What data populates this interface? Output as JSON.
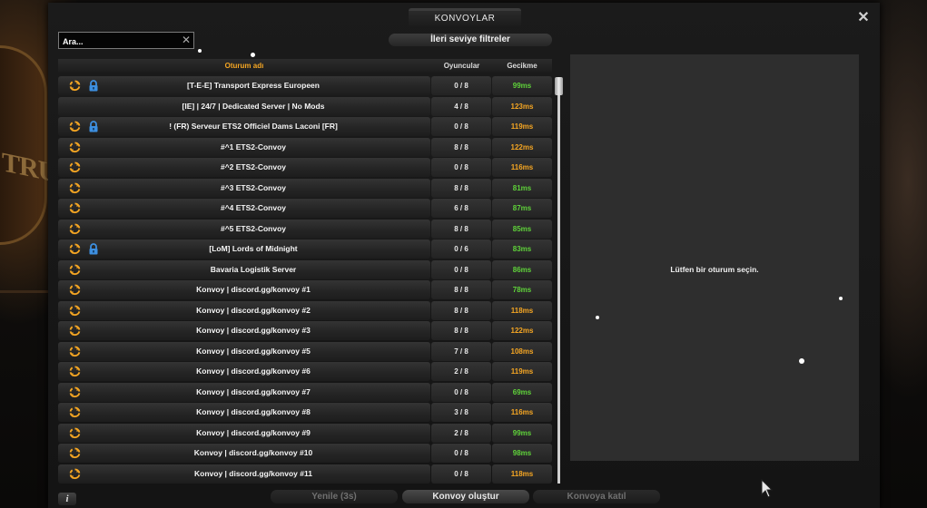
{
  "window": {
    "title": "KONVOYLAR",
    "close_label": "✕"
  },
  "search": {
    "placeholder": "Ara...",
    "value": ""
  },
  "filters_button": {
    "label": "İleri seviye filtreler"
  },
  "table": {
    "headers": {
      "name": "Oturum adı",
      "players": "Oyuncular",
      "delay": "Gecikme"
    },
    "rows": [
      {
        "name": "[T-E-E] Transport Express Europeen",
        "players": "0 / 8",
        "ping": "99ms",
        "ping_level": "good",
        "locked": true,
        "synced": true
      },
      {
        "name": "[IE] | 24/7 | Dedicated Server | No Mods",
        "players": "4 / 8",
        "ping": "123ms",
        "ping_level": "mid",
        "locked": false,
        "synced": false
      },
      {
        "name": "! (FR) Serveur ETS2 Officiel Dams Laconi [FR]",
        "players": "0 / 8",
        "ping": "119ms",
        "ping_level": "mid",
        "locked": true,
        "synced": true
      },
      {
        "name": "#^1 ETS2-Convoy",
        "players": "8 / 8",
        "ping": "122ms",
        "ping_level": "mid",
        "locked": false,
        "synced": true
      },
      {
        "name": "#^2 ETS2-Convoy",
        "players": "0 / 8",
        "ping": "116ms",
        "ping_level": "mid",
        "locked": false,
        "synced": true
      },
      {
        "name": "#^3 ETS2-Convoy",
        "players": "8 / 8",
        "ping": "81ms",
        "ping_level": "good",
        "locked": false,
        "synced": true
      },
      {
        "name": "#^4 ETS2-Convoy",
        "players": "6 / 8",
        "ping": "87ms",
        "ping_level": "good",
        "locked": false,
        "synced": true
      },
      {
        "name": "#^5 ETS2-Convoy",
        "players": "8 / 8",
        "ping": "85ms",
        "ping_level": "good",
        "locked": false,
        "synced": true
      },
      {
        "name": "[LoM] Lords of Midnight",
        "players": "0 / 6",
        "ping": "83ms",
        "ping_level": "good",
        "locked": true,
        "synced": true
      },
      {
        "name": "Bavaria Logistik Server",
        "players": "0 / 8",
        "ping": "86ms",
        "ping_level": "good",
        "locked": false,
        "synced": true
      },
      {
        "name": "Konvoy | discord.gg/konvoy #1",
        "players": "8 / 8",
        "ping": "78ms",
        "ping_level": "good",
        "locked": false,
        "synced": true
      },
      {
        "name": "Konvoy | discord.gg/konvoy #2",
        "players": "8 / 8",
        "ping": "118ms",
        "ping_level": "mid",
        "locked": false,
        "synced": true
      },
      {
        "name": "Konvoy | discord.gg/konvoy #3",
        "players": "8 / 8",
        "ping": "122ms",
        "ping_level": "mid",
        "locked": false,
        "synced": true
      },
      {
        "name": "Konvoy | discord.gg/konvoy #5",
        "players": "7 / 8",
        "ping": "108ms",
        "ping_level": "mid",
        "locked": false,
        "synced": true
      },
      {
        "name": "Konvoy | discord.gg/konvoy #6",
        "players": "2 / 8",
        "ping": "119ms",
        "ping_level": "mid",
        "locked": false,
        "synced": true
      },
      {
        "name": "Konvoy | discord.gg/konvoy #7",
        "players": "0 / 8",
        "ping": "69ms",
        "ping_level": "good",
        "locked": false,
        "synced": true
      },
      {
        "name": "Konvoy | discord.gg/konvoy #8",
        "players": "3 / 8",
        "ping": "116ms",
        "ping_level": "mid",
        "locked": false,
        "synced": true
      },
      {
        "name": "Konvoy | discord.gg/konvoy #9",
        "players": "2 / 8",
        "ping": "99ms",
        "ping_level": "good",
        "locked": false,
        "synced": true
      },
      {
        "name": "Konvoy | discord.gg/konvoy #10",
        "players": "0 / 8",
        "ping": "98ms",
        "ping_level": "good",
        "locked": false,
        "synced": true
      },
      {
        "name": "Konvoy | discord.gg/konvoy #11",
        "players": "0 / 8",
        "ping": "118ms",
        "ping_level": "mid",
        "locked": false,
        "synced": true
      }
    ]
  },
  "details": {
    "message": "Lütfen bir oturum seçin."
  },
  "buttons": {
    "info": "i",
    "refresh": "Yenile (3s)",
    "create": "Konvoy oluştur",
    "join": "Konvoya katıl"
  },
  "background": {
    "sign_text": "TRUCK"
  },
  "colors": {
    "accent": "#f5a623",
    "ping_good": "#5fd23a",
    "ping_mid": "#f5a623",
    "lock": "#3d8fe0"
  }
}
